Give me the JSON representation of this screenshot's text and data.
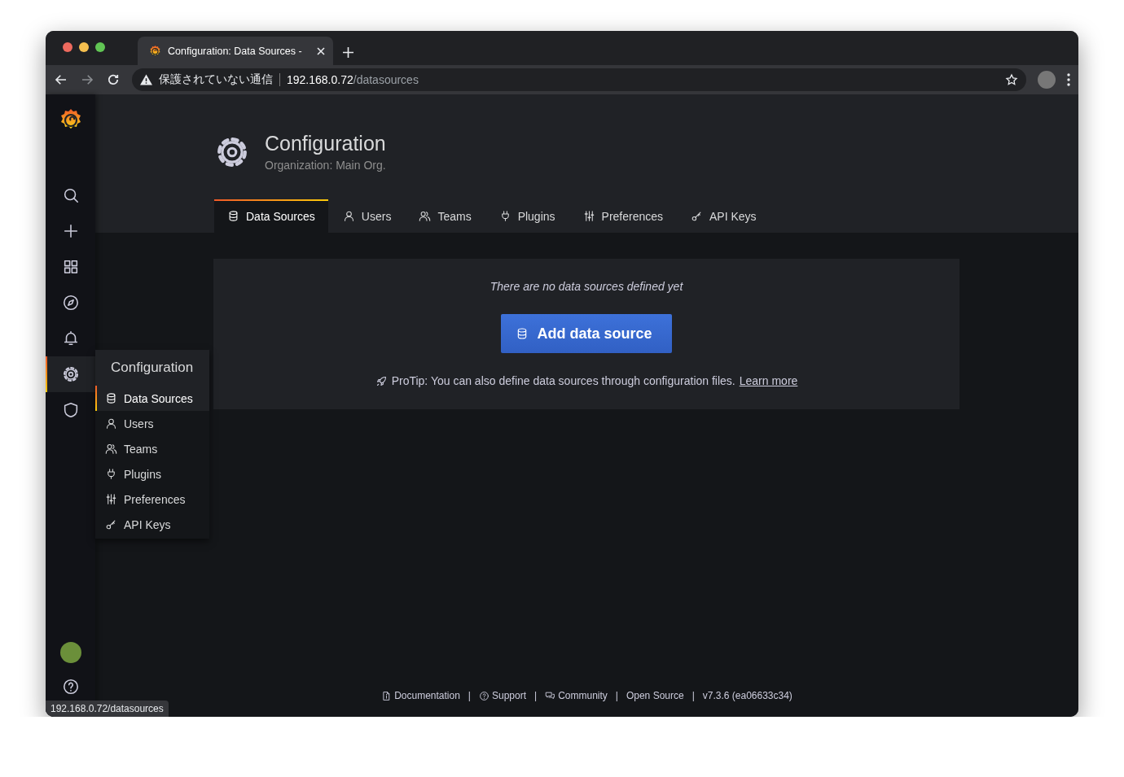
{
  "browser": {
    "tab_title": "Configuration: Data Sources -",
    "security_label": "保護されていない通信",
    "host": "192.168.0.72",
    "path": "/datasources",
    "status_url": "192.168.0.72/datasources"
  },
  "sidebar": {
    "items": [
      {
        "kind": "search",
        "selected": false
      },
      {
        "kind": "plus",
        "selected": false
      },
      {
        "kind": "grid",
        "selected": false
      },
      {
        "kind": "compass",
        "selected": false
      },
      {
        "kind": "bell",
        "selected": false
      },
      {
        "kind": "gear",
        "selected": true
      },
      {
        "kind": "shield",
        "selected": false
      }
    ],
    "flyout": {
      "title": "Configuration",
      "items": [
        {
          "label": "Data Sources",
          "kind": "database",
          "selected": true
        },
        {
          "label": "Users",
          "kind": "user",
          "selected": false
        },
        {
          "label": "Teams",
          "kind": "users",
          "selected": false
        },
        {
          "label": "Plugins",
          "kind": "plug",
          "selected": false
        },
        {
          "label": "Preferences",
          "kind": "sliders",
          "selected": false
        },
        {
          "label": "API Keys",
          "kind": "key",
          "selected": false
        }
      ]
    }
  },
  "header": {
    "title": "Configuration",
    "subtitle": "Organization: Main Org.",
    "tabs": [
      {
        "label": "Data Sources",
        "kind": "database",
        "selected": true
      },
      {
        "label": "Users",
        "kind": "user",
        "selected": false
      },
      {
        "label": "Teams",
        "kind": "users",
        "selected": false
      },
      {
        "label": "Plugins",
        "kind": "plug",
        "selected": false
      },
      {
        "label": "Preferences",
        "kind": "sliders",
        "selected": false
      },
      {
        "label": "API Keys",
        "kind": "key",
        "selected": false
      }
    ]
  },
  "empty_state": {
    "message": "There are no data sources defined yet",
    "button": "Add data source",
    "protip": "ProTip: You can also define data sources through configuration files.",
    "link": "Learn more"
  },
  "footer": {
    "items": [
      {
        "kind": "doc",
        "label": "Documentation"
      },
      {
        "kind": "separator",
        "label": "|"
      },
      {
        "kind": "help",
        "label": "Support"
      },
      {
        "kind": "separator",
        "label": "|"
      },
      {
        "kind": "comments",
        "label": "Community"
      },
      {
        "kind": "separator",
        "label": "|"
      },
      {
        "kind": "link",
        "label": "Open Source"
      },
      {
        "kind": "separator",
        "label": "|"
      },
      {
        "kind": "text",
        "label": "v7.3.6 (ea06633c34)"
      }
    ]
  }
}
